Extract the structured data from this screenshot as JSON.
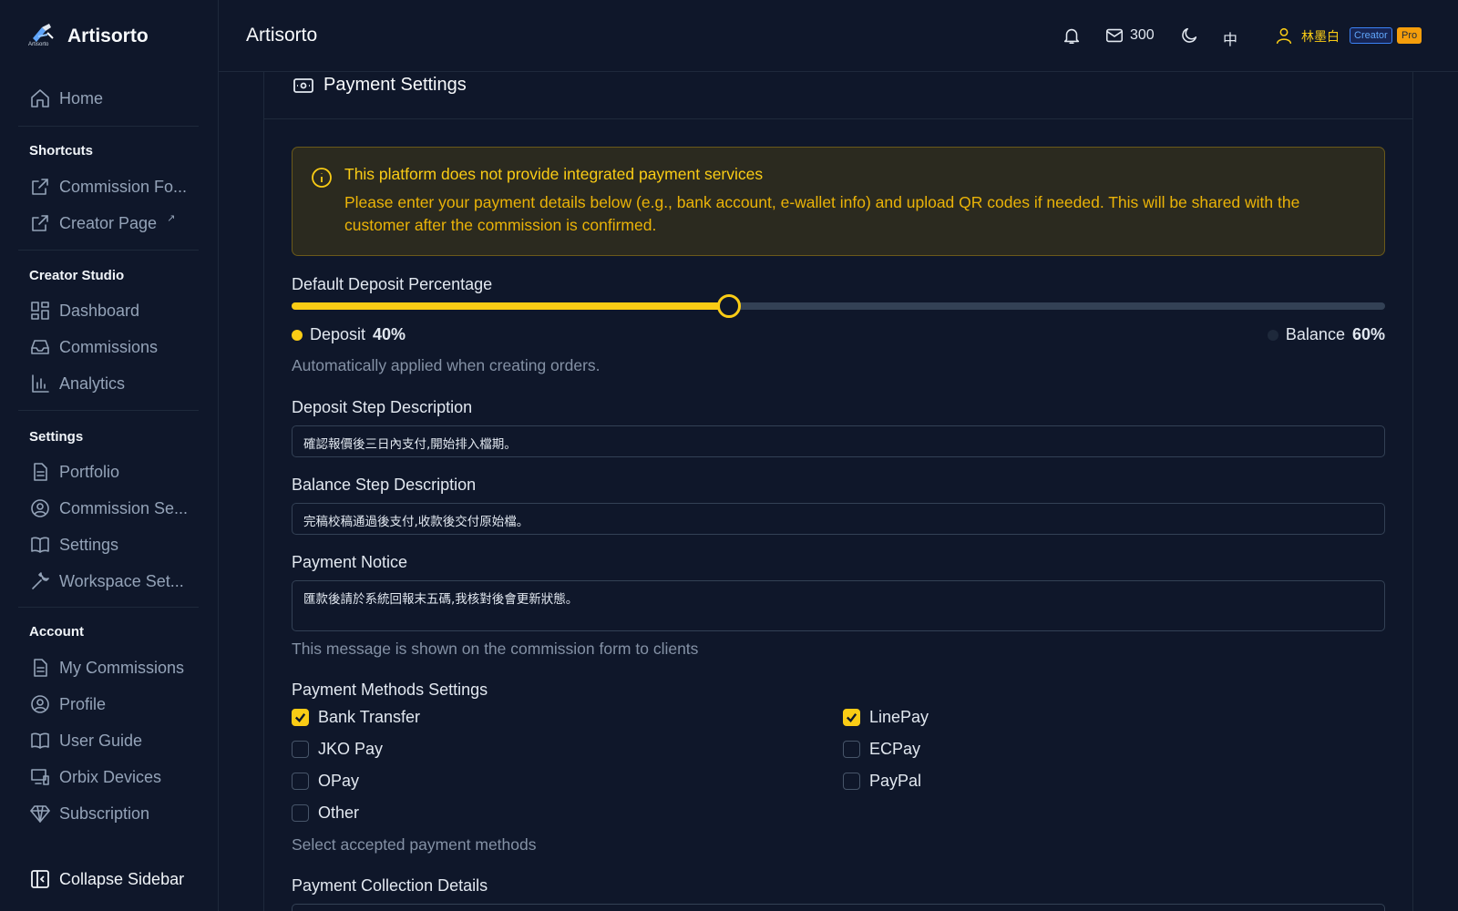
{
  "app": {
    "brand": "Artisorto",
    "brand_sub": "Artisorto",
    "header_title": "Artisorto"
  },
  "colors": {
    "accent": "#facc15",
    "background": "#0f172a",
    "muted": "#334155"
  },
  "sidebar": {
    "home": "Home",
    "sections": {
      "shortcuts": "Shortcuts",
      "creator_studio": "Creator Studio",
      "settings": "Settings",
      "account": "Account"
    },
    "shortcuts": [
      {
        "label": "Commission Fo...",
        "icon": "external-link-icon"
      },
      {
        "label": "Creator Page",
        "icon": "external-link-icon",
        "ext": "↗"
      }
    ],
    "creator_studio": [
      {
        "label": "Dashboard",
        "icon": "dashboard-icon"
      },
      {
        "label": "Commissions",
        "icon": "inbox-icon"
      },
      {
        "label": "Analytics",
        "icon": "bar-chart-icon"
      }
    ],
    "settings": [
      {
        "label": "Portfolio",
        "icon": "document-icon"
      },
      {
        "label": "Commission Se...",
        "icon": "user-circle-icon"
      },
      {
        "label": "Settings",
        "icon": "book-icon"
      },
      {
        "label": "Workspace Set...",
        "icon": "wrench-icon"
      }
    ],
    "account": [
      {
        "label": "My Commissions",
        "icon": "document-icon"
      },
      {
        "label": "Profile",
        "icon": "user-circle-icon"
      },
      {
        "label": "User Guide",
        "icon": "book-icon"
      },
      {
        "label": "Orbix Devices",
        "icon": "devices-icon"
      },
      {
        "label": "Subscription",
        "icon": "diamond-icon"
      }
    ],
    "collapse": "Collapse Sidebar"
  },
  "header": {
    "mail_count": "300",
    "language": "中",
    "user_name": "林墨白",
    "badge_creator": "Creator",
    "badge_pro": "Pro"
  },
  "main": {
    "title": "Payment Settings",
    "alert": {
      "title": "This platform does not provide integrated payment services",
      "body": "Please enter your payment details below (e.g., bank account, e-wallet info) and upload QR codes if needed. This will be shared with the customer after the commission is confirmed."
    },
    "deposit": {
      "label": "Default Deposit Percentage",
      "deposit_label": "Deposit",
      "deposit_value": "40%",
      "balance_label": "Balance",
      "balance_value": "60%",
      "deposit_fraction": 0.4,
      "helper": "Automatically applied when creating orders."
    },
    "deposit_step": {
      "label": "Deposit Step Description",
      "value": "確認報價後三日內支付,開始排入檔期。"
    },
    "balance_step": {
      "label": "Balance Step Description",
      "value": "完稿校稿通過後支付,收款後交付原始檔。"
    },
    "payment_notice": {
      "label": "Payment Notice",
      "value": "匯款後請於系統回報末五碼,我核對後會更新狀態。",
      "helper": "This message is shown on the commission form to clients"
    },
    "methods": {
      "label": "Payment Methods Settings",
      "helper": "Select accepted payment methods",
      "items": [
        {
          "label": "Bank Transfer",
          "checked": true
        },
        {
          "label": "LinePay",
          "checked": true
        },
        {
          "label": "JKO Pay",
          "checked": false
        },
        {
          "label": "ECPay",
          "checked": false
        },
        {
          "label": "OPay",
          "checked": false
        },
        {
          "label": "PayPal",
          "checked": false
        },
        {
          "label": "Other",
          "checked": false
        }
      ]
    },
    "collection": {
      "label": "Payment Collection Details"
    }
  }
}
